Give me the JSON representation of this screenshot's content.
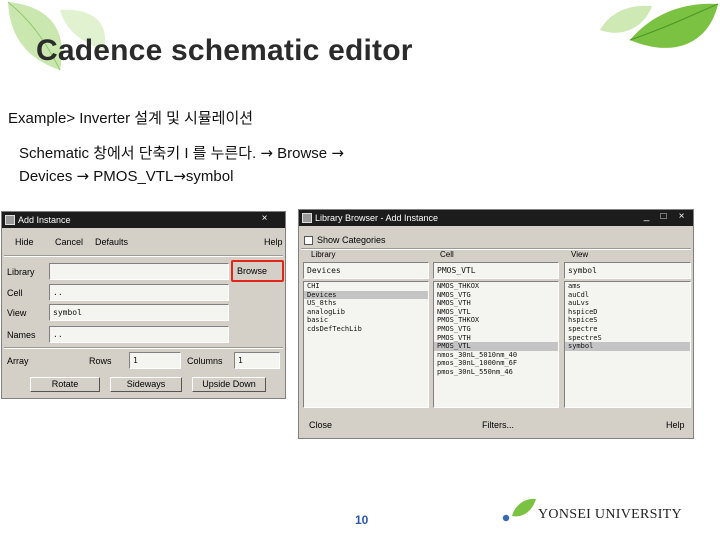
{
  "slide": {
    "title": "Cadence schematic editor",
    "subtitle": "Example> Inverter 설계 및 시뮬레이션",
    "instruction_line1_prefix": "Schematic 창에서 단축키 I 를 누른다. ",
    "instruction_line1_arrow": "→",
    "instruction_line1_suffix": " Browse ",
    "instruction_line1_arrow2": "→",
    "instruction_line2_prefix": "Devices ",
    "instruction_line2_arrow": "→",
    "instruction_line2_mid": " PMOS_VTL",
    "instruction_line2_arrow2": "→",
    "instruction_line2_suffix": "symbol",
    "page_number": "10",
    "university": "YONSEI UNIVERSITY"
  },
  "add_instance": {
    "title": "Add Instance",
    "close_glyph": "×",
    "menu": {
      "hide": "Hide",
      "cancel": "Cancel",
      "defaults": "Defaults",
      "help": "Help"
    },
    "labels": {
      "library": "Library",
      "cell": "Cell",
      "view": "View",
      "names": "Names",
      "array": "Array",
      "rows": "Rows",
      "columns": "Columns"
    },
    "values": {
      "library": "",
      "cell": "..",
      "view": "symbol",
      "names": "..",
      "rows": "1",
      "columns": "1"
    },
    "browse_label": "Browse",
    "buttons": {
      "rotate": "Rotate",
      "sideways": "Sideways",
      "upside_down": "Upside Down"
    }
  },
  "library_browser": {
    "title": "Library Browser - Add Instance",
    "show_categories": "Show Categories",
    "headers": {
      "library": "Library",
      "cell": "Cell",
      "view": "View"
    },
    "filters": {
      "library": "Devices",
      "cell": "PMOS_VTL",
      "view": "symbol"
    },
    "libraries": [
      {
        "text": "CHI",
        "selected": false
      },
      {
        "text": "Devices",
        "selected": true
      },
      {
        "text": "US_8ths",
        "selected": false
      },
      {
        "text": "analogLib",
        "selected": false
      },
      {
        "text": "basic",
        "selected": false
      },
      {
        "text": "cdsDefTechLib",
        "selected": false
      }
    ],
    "cells": [
      {
        "text": "NMOS_THKOX",
        "selected": false
      },
      {
        "text": "NMOS_VTG",
        "selected": false
      },
      {
        "text": "NMOS_VTH",
        "selected": false
      },
      {
        "text": "NMOS_VTL",
        "selected": false
      },
      {
        "text": "PMOS_THKOX",
        "selected": false
      },
      {
        "text": "PMOS_VTG",
        "selected": false
      },
      {
        "text": "PMOS_VTH",
        "selected": false
      },
      {
        "text": "PMOS_VTL",
        "selected": true
      },
      {
        "text": "nmos_30nL_5010nm_40",
        "selected": false
      },
      {
        "text": "pmos_30nL_1000nm_6F",
        "selected": false
      },
      {
        "text": "pmos_30nL_550nm_46",
        "selected": false
      }
    ],
    "views": [
      {
        "text": "ams",
        "selected": false
      },
      {
        "text": "auCdl",
        "selected": false
      },
      {
        "text": "auLvs",
        "selected": false
      },
      {
        "text": "hspiceD",
        "selected": false
      },
      {
        "text": "hspiceS",
        "selected": false
      },
      {
        "text": "spectre",
        "selected": false
      },
      {
        "text": "spectreS",
        "selected": false
      },
      {
        "text": "symbol",
        "selected": true
      }
    ],
    "buttons": {
      "close": "Close",
      "filters": "Filters...",
      "help": "Help"
    },
    "window_glyphs": {
      "min": "_",
      "max": "□",
      "close": "×"
    }
  },
  "colors": {
    "highlight": "#e3261b",
    "titlebar": "#1c1c1c",
    "window_bg": "#d4d0c8",
    "page_number": "#2a58a8",
    "leaf_green": "#7cc242"
  }
}
